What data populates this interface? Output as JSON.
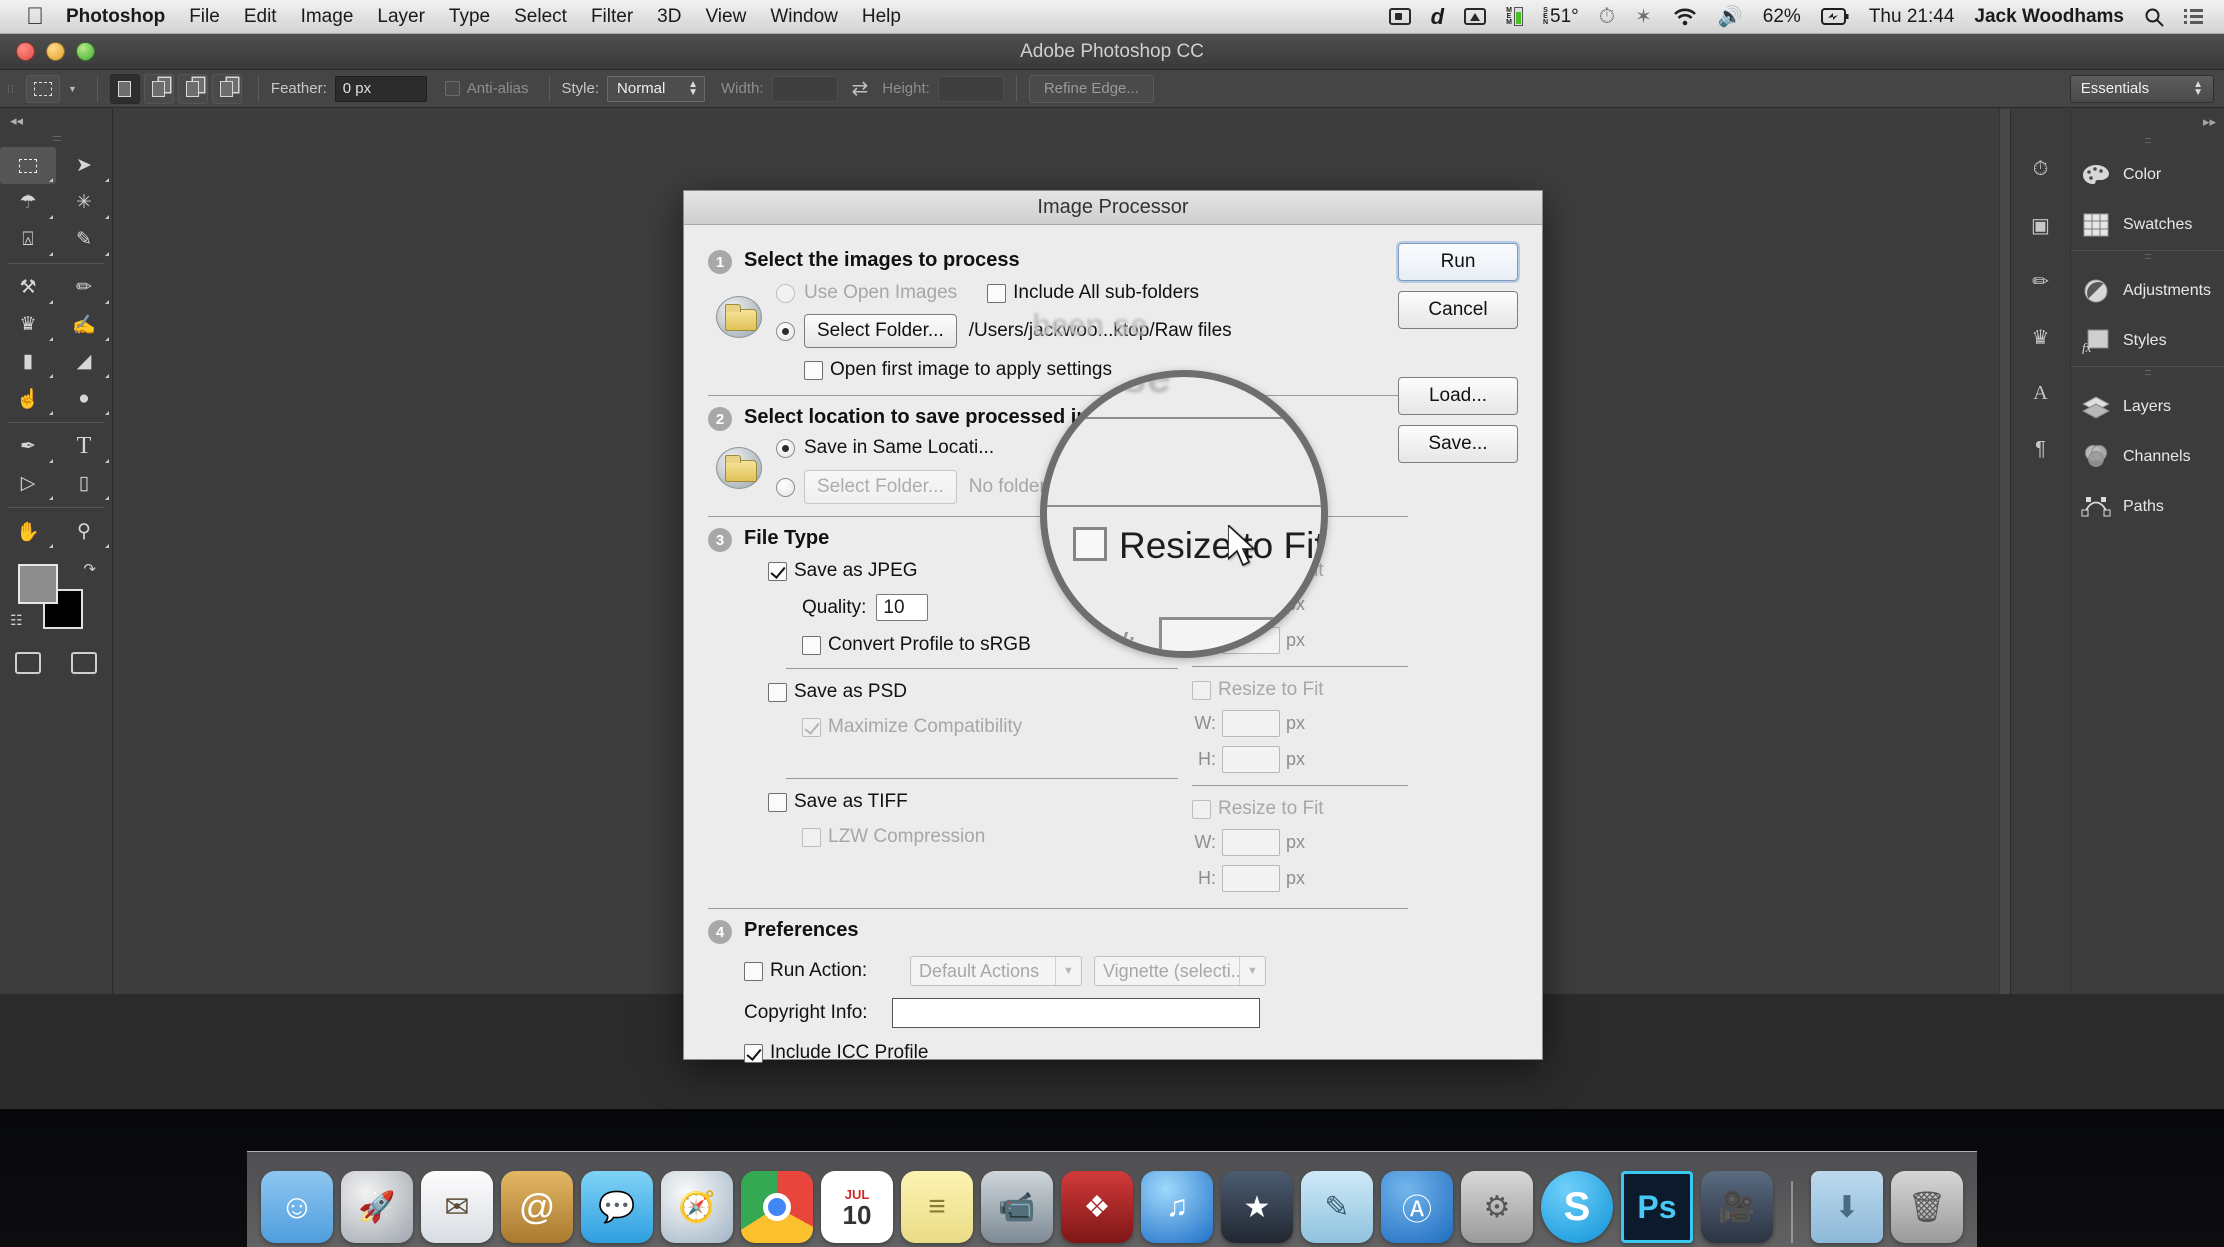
{
  "menubar": {
    "apple_glyph": "",
    "items": [
      {
        "label": "Photoshop",
        "bold": true
      },
      {
        "label": "File"
      },
      {
        "label": "Edit"
      },
      {
        "label": "Image"
      },
      {
        "label": "Layer"
      },
      {
        "label": "Type"
      },
      {
        "label": "Select"
      },
      {
        "label": "Filter"
      },
      {
        "label": "3D"
      },
      {
        "label": "View"
      },
      {
        "label": "Window"
      },
      {
        "label": "Help"
      }
    ],
    "status": {
      "screen_recorder_icon": "screen-recording-icon",
      "dropbox_icon": "d",
      "airplay_icon": "airplay-icon",
      "memory_label": "MEM",
      "sensor_label": "SEN",
      "temperature": "51°",
      "time_machine_icon": "time-machine-icon",
      "bluetooth_icon": "✶",
      "wifi_icon": "wifi-icon",
      "volume_icon": "🔊",
      "battery_percent": "62%",
      "battery_icon": "battery-icon",
      "clock": "Thu 21:44",
      "user": "Jack Woodhams",
      "search_icon": "search-icon",
      "notification_icon": "notification-center-icon"
    }
  },
  "window": {
    "title": "Adobe Photoshop CC"
  },
  "options_bar": {
    "tool_icon": "rectangular-marquee-icon",
    "feather_label": "Feather:",
    "feather_value": "0 px",
    "antialias_label": "Anti-alias",
    "style_label": "Style:",
    "style_value": "Normal",
    "width_label": "Width:",
    "width_value": "",
    "height_label": "Height:",
    "height_value": "",
    "refine_edge_label": "Refine Edge...",
    "workspace_label": "Essentials"
  },
  "toolbar": {
    "tools": [
      {
        "name": "rectangular-marquee-tool",
        "glyph": "marquee"
      },
      {
        "name": "move-tool",
        "glyph": "➤"
      },
      {
        "name": "lasso-tool",
        "glyph": "✠"
      },
      {
        "name": "magic-wand-tool",
        "glyph": "✳"
      },
      {
        "name": "crop-tool",
        "glyph": "⌗"
      },
      {
        "name": "eyedropper-tool",
        "glyph": "✒"
      },
      {
        "name": "spot-healing-brush-tool",
        "glyph": "✒"
      },
      {
        "name": "brush-tool",
        "glyph": "✎"
      },
      {
        "name": "clone-stamp-tool",
        "glyph": "♟"
      },
      {
        "name": "history-brush-tool",
        "glyph": "✍"
      },
      {
        "name": "eraser-tool",
        "glyph": "▰"
      },
      {
        "name": "gradient-tool",
        "glyph": "◢"
      },
      {
        "name": "blur-tool",
        "glyph": "●"
      },
      {
        "name": "dodge-tool",
        "glyph": "○"
      },
      {
        "name": "pen-tool",
        "glyph": "✒"
      },
      {
        "name": "type-tool",
        "glyph": "T"
      },
      {
        "name": "path-selection-tool",
        "glyph": "▷"
      },
      {
        "name": "rectangle-tool",
        "glyph": "▭"
      },
      {
        "name": "hand-tool",
        "glyph": "✋"
      },
      {
        "name": "zoom-tool",
        "glyph": "⚲"
      }
    ],
    "foreground_color": "#8d8d8d",
    "background_color": "#000000"
  },
  "right_panel": {
    "groups": [
      {
        "items": [
          {
            "label": "Color",
            "icon": "color-palette-icon"
          },
          {
            "label": "Swatches",
            "icon": "swatches-grid-icon"
          }
        ]
      },
      {
        "items": [
          {
            "label": "Adjustments",
            "icon": "adjustments-circle-icon"
          },
          {
            "label": "Styles",
            "icon": "styles-fx-icon"
          }
        ]
      },
      {
        "items": [
          {
            "label": "Layers",
            "icon": "layers-stack-icon"
          },
          {
            "label": "Channels",
            "icon": "channels-venn-icon"
          },
          {
            "label": "Paths",
            "icon": "paths-bezier-icon"
          }
        ]
      }
    ]
  },
  "dialog": {
    "title": "Image Processor",
    "buttons": {
      "run": "Run",
      "cancel": "Cancel",
      "load": "Load...",
      "save": "Save..."
    },
    "step1": {
      "number": "1",
      "title": "Select the images to process",
      "use_open_images_label": "Use Open Images",
      "use_open_images_selected": false,
      "use_open_images_disabled": true,
      "include_subfolders_label": "Include All sub-folders",
      "include_subfolders_checked": false,
      "select_folder_button": "Select Folder...",
      "selected_folder_path": "/Users/jackwoo...ktop/Raw files",
      "select_folder_selected": true,
      "open_first_image_label": "Open first image to apply settings",
      "open_first_image_checked": false
    },
    "step2": {
      "number": "2",
      "title": "Select location to save processed images",
      "save_same_location_label": "Save in Same Locati...",
      "save_same_location_selected": true,
      "select_folder_button": "Select Folder...",
      "no_folder_text": "No folder has been selected",
      "select_folder_selected": false
    },
    "step3": {
      "number": "3",
      "title": "File Type",
      "jpeg": {
        "label": "Save as JPEG",
        "checked": true,
        "quality_label": "Quality:",
        "quality_value": "10",
        "convert_srgb_label": "Convert Profile to sRGB",
        "convert_srgb_checked": false,
        "resize_label": "Resize to Fit",
        "resize_checked": false,
        "w_label": "W:",
        "w_value": "",
        "h_label": "H:",
        "h_value": "",
        "unit": "px"
      },
      "psd": {
        "label": "Save as PSD",
        "checked": false,
        "maximize_label": "Maximize Compatibility",
        "maximize_checked": true,
        "resize_label": "Resize to Fit",
        "resize_checked": false,
        "w_label": "W:",
        "w_value": "",
        "h_label": "H:",
        "h_value": "",
        "unit": "px"
      },
      "tiff": {
        "label": "Save as TIFF",
        "checked": false,
        "lzw_label": "LZW Compression",
        "lzw_checked": false,
        "resize_label": "Resize to Fit",
        "resize_checked": false,
        "w_label": "W:",
        "w_value": "",
        "h_label": "H:",
        "h_value": "",
        "unit": "px"
      }
    },
    "step4": {
      "number": "4",
      "title": "Preferences",
      "run_action_label": "Run Action:",
      "run_action_checked": false,
      "action_set_value": "Default Actions",
      "action_value": "Vignette (selecti...",
      "copyright_label": "Copyright Info:",
      "copyright_value": "",
      "include_icc_label": "Include ICC Profile",
      "include_icc_checked": true
    }
  },
  "loupe": {
    "ghost_text": "been se",
    "magnified_label": "Resize to Fit",
    "w_label": "W:",
    "unit": "px"
  },
  "dock": {
    "items": [
      {
        "name": "finder",
        "label": "Finder",
        "bg": "#4f9ede",
        "glyph": "☺"
      },
      {
        "name": "launchpad",
        "label": "Launchpad",
        "bg": "#b9bfc6",
        "glyph": "🚀"
      },
      {
        "name": "mail",
        "label": "Mail",
        "bg": "#dfe6ee",
        "glyph": "✉"
      },
      {
        "name": "contacts",
        "label": "Contacts",
        "bg": "#c08f4a",
        "glyph": "@"
      },
      {
        "name": "messages",
        "label": "Messages",
        "bg": "#4db6f0",
        "glyph": "💬"
      },
      {
        "name": "safari",
        "label": "Safari",
        "bg": "#cfd7de",
        "glyph": "🧭"
      },
      {
        "name": "chrome",
        "label": "Google Chrome",
        "bg": "#f2f2f2",
        "glyph": "●"
      },
      {
        "name": "calendar",
        "label": "Calendar",
        "bg": "#ffffff",
        "glyph": "10"
      },
      {
        "name": "notes",
        "label": "Notes",
        "bg": "#f5e9a8",
        "glyph": "≡"
      },
      {
        "name": "facetime",
        "label": "FaceTime",
        "bg": "#5b6a74",
        "glyph": "📹"
      },
      {
        "name": "iphoto",
        "label": "iPhoto",
        "bg": "#b02a2a",
        "glyph": "❖"
      },
      {
        "name": "itunes",
        "label": "iTunes",
        "bg": "#2d8fe0",
        "glyph": "♫"
      },
      {
        "name": "imovie",
        "label": "iMovie",
        "bg": "#2b2b33",
        "glyph": "★"
      },
      {
        "name": "preview",
        "label": "Preview",
        "bg": "#9fd3ef",
        "glyph": "✏"
      },
      {
        "name": "app-store",
        "label": "App Store",
        "bg": "#2f7fd0",
        "glyph": "Ⓐ"
      },
      {
        "name": "system-preferences",
        "label": "System Preferences",
        "bg": "#b7b7b7",
        "glyph": "⚙"
      },
      {
        "name": "skype",
        "label": "Skype",
        "bg": "#1fa9e8",
        "glyph": "S"
      },
      {
        "name": "photoshop",
        "label": "Adobe Photoshop",
        "bg": "#0f1c2b",
        "glyph": "Ps"
      },
      {
        "name": "final-cut",
        "label": "Final Cut",
        "bg": "#45536a",
        "glyph": "🎬"
      }
    ],
    "right_items": [
      {
        "name": "downloads-folder",
        "label": "Downloads",
        "bg": "#9fc6e4",
        "glyph": "⬇"
      },
      {
        "name": "trash",
        "label": "Trash",
        "bg": "#9aa0a6",
        "glyph": "🗑"
      }
    ]
  }
}
